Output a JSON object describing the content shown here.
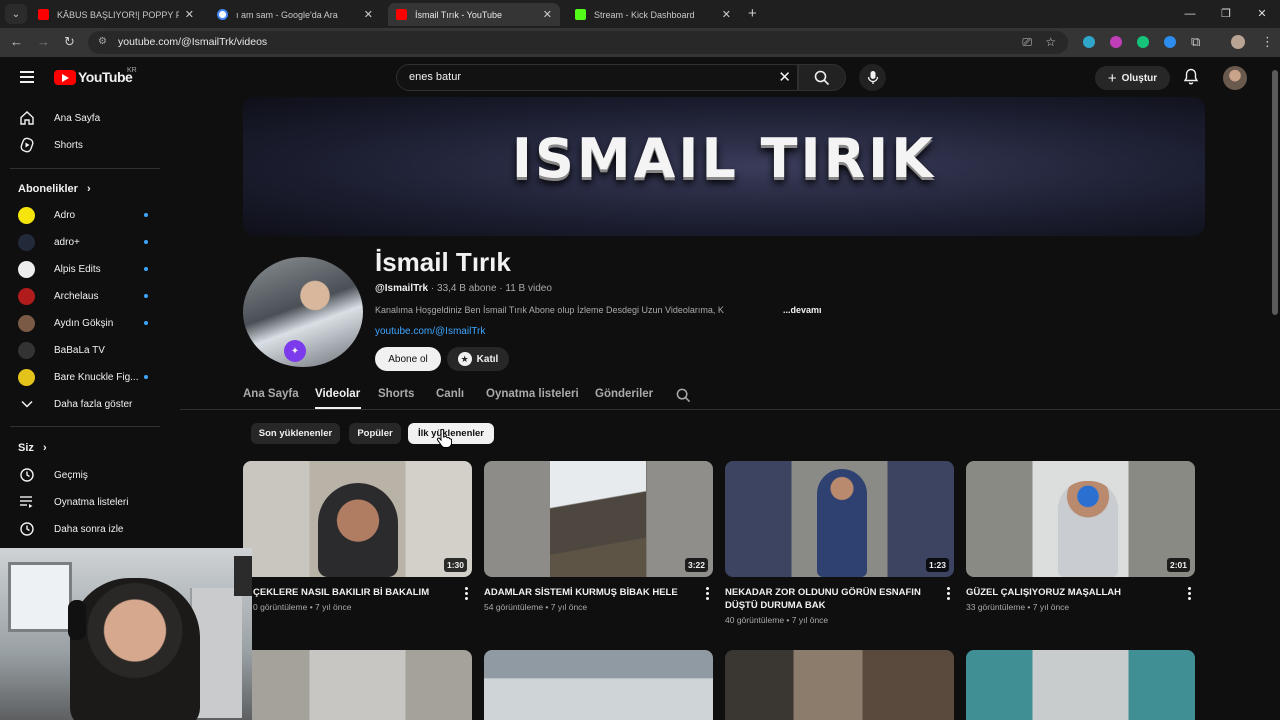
{
  "browser": {
    "tabs": [
      {
        "title": "KÂBUS BAŞLIYOR!| POPPY PLAY",
        "favicon_color": "#ff0000",
        "active": false
      },
      {
        "title": "ı am sam - Google'da Ara",
        "favicon_color": "#4285f4",
        "active": false
      },
      {
        "title": "İsmail Tırık - YouTube",
        "favicon_color": "#ff0000",
        "active": true
      },
      {
        "title": "Stream - Kick Dashboard",
        "favicon_color": "#53fc18",
        "active": false
      }
    ],
    "url": "youtube.com/@IsmailTrk/videos"
  },
  "masthead": {
    "logo_text": "YouTube",
    "country_code": "KR",
    "search_query": "enes batur",
    "create_label": "Oluştur"
  },
  "sidebar": {
    "main": [
      {
        "label": "Ana Sayfa",
        "icon": "home-icon"
      },
      {
        "label": "Shorts",
        "icon": "shorts-icon"
      }
    ],
    "subscriptions_title": "Abonelikler",
    "subscriptions": [
      {
        "label": "Adro",
        "color": "#f5e50a"
      },
      {
        "label": "adro+",
        "color": "#222a3a"
      },
      {
        "label": "Alpis Edits",
        "color": "#eeeeee"
      },
      {
        "label": "Archelaus",
        "color": "#b01c1c"
      },
      {
        "label": "Aydın Gökşin",
        "color": "#7a5a44"
      },
      {
        "label": "BaBaLa TV",
        "color": "#333333"
      },
      {
        "label": "Bare Knuckle Fig...",
        "color": "#e3c21a"
      }
    ],
    "show_more": "Daha fazla göster",
    "you_title": "Siz",
    "you_items": [
      {
        "label": "Geçmiş",
        "icon": "history-icon"
      },
      {
        "label": "Oynatma listeleri",
        "icon": "playlists-icon"
      },
      {
        "label": "Daha sonra izle",
        "icon": "watch-later-icon"
      }
    ]
  },
  "channel": {
    "banner_text": "ISMAIL TIRIK",
    "name": "İsmail Tırık",
    "handle": "@IsmailTrk",
    "stats": " · 33,4 B abone · 11 B video",
    "description": "Kanalıma Hoşgeldiniz Ben İsmail Tırık Abone olup İzleme Desdegi Uzun Videolarıma, K",
    "more": "...devamı",
    "link": "youtube.com/@IsmailTrk",
    "subscribe": "Abone ol",
    "join": "Katıl",
    "tabs": [
      "Ana Sayfa",
      "Videolar",
      "Shorts",
      "Canlı",
      "Oynatma listeleri",
      "Gönderiler"
    ],
    "active_tab": "Videolar"
  },
  "chips": [
    "Son yüklenenler",
    "Popüler",
    "İlk yüklenenler"
  ],
  "active_chip": "İlk yüklenenler",
  "videos": [
    {
      "title": "ÇEKLERE NASIL BAKILIR Bİ BAKALIM",
      "duration": "1:30",
      "meta": "0 görüntüleme • 7 yıl önce"
    },
    {
      "title": "ADAMLAR SİSTEMİ KURMUŞ BİBAK HELE",
      "duration": "3:22",
      "meta": "54 görüntüleme • 7 yıl önce"
    },
    {
      "title": "NEKADAR ZOR OLDUNU GÖRÜN ESNAFIN DÜŞTÜ DURUMA BAK",
      "duration": "1:23",
      "meta": "40 görüntüleme • 7 yıl önce"
    },
    {
      "title": "GÜZEL ÇALIŞIYORUZ MAŞALLAH",
      "duration": "2:01",
      "meta": "33 görüntüleme • 7 yıl önce"
    }
  ]
}
